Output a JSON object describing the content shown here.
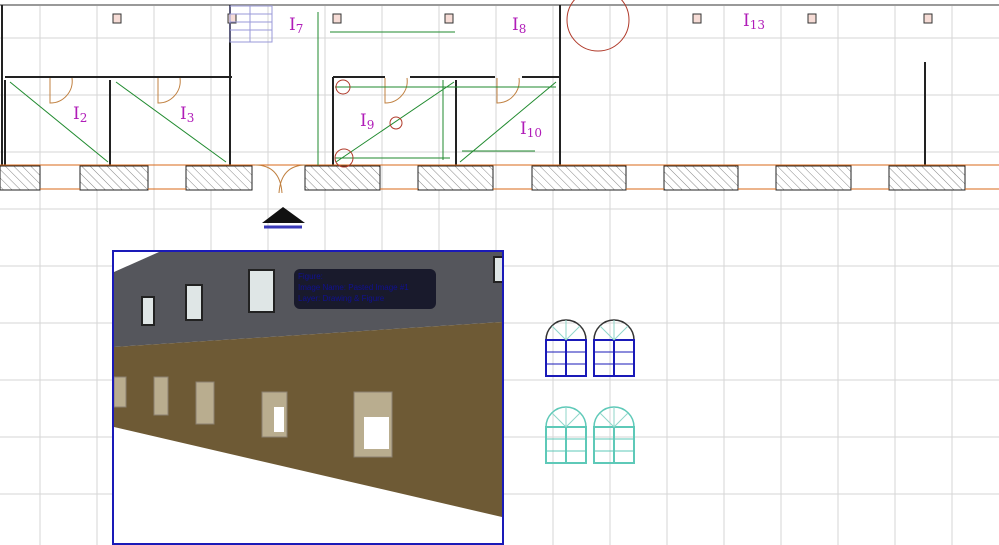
{
  "rooms": [
    {
      "name": "I",
      "num": "2"
    },
    {
      "name": "I",
      "num": "3"
    },
    {
      "name": "I",
      "num": "7"
    },
    {
      "name": "I",
      "num": "8"
    },
    {
      "name": "I",
      "num": "9"
    },
    {
      "name": "I",
      "num": "10"
    },
    {
      "name": "I",
      "num": "13"
    }
  ],
  "tooltip": {
    "line1": "Figure:",
    "line2": "Image Name: Pasted Image #1",
    "line3": "Layer: Drawing & Figure"
  },
  "colors": {
    "label": "#b01cb8",
    "dimension": "#1f8a2e",
    "selection": "#1a1ab8",
    "window_selected": "#1a1ab8",
    "window": "#5ec9b8",
    "facade_upper": "#55565c",
    "facade_lower": "#6e5a35"
  }
}
